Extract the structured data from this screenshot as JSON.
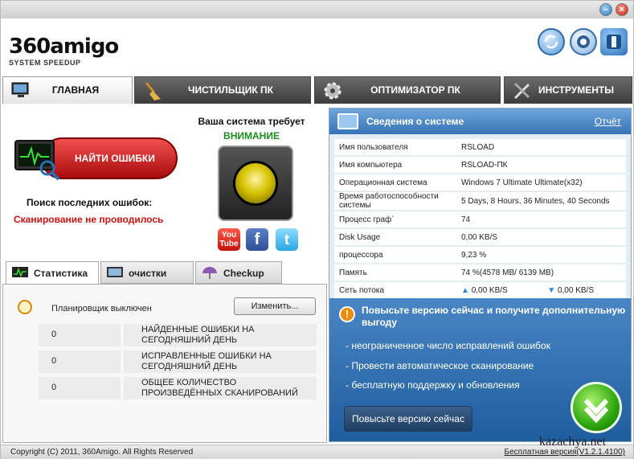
{
  "logo": {
    "brand": "360amigo",
    "sub": "SYSTEM SPEEDUP"
  },
  "window_controls": {
    "minimize_glyph": "–",
    "close_glyph": "×"
  },
  "header_icons": [
    "refresh-icon",
    "settings-gear-icon",
    "lifebuoy-icon"
  ],
  "tabs": [
    {
      "label": "ГЛАВНАЯ",
      "icon": "monitor-icon",
      "active": true
    },
    {
      "label": "ЧИСТИЛЬЩИК ПК",
      "icon": "broom-icon",
      "active": false
    },
    {
      "label": "ОПТИМИЗАТОР ПК",
      "icon": "gear-icon",
      "active": false
    },
    {
      "label": "ИНСТРУМЕНТЫ",
      "icon": "tools-icon",
      "active": false
    }
  ],
  "main": {
    "find_errors_label": "НАЙТИ ОШИБКИ",
    "search_title": "Поиск последних ошибок:",
    "scan_status": "Сканирование не проводилось",
    "system_requires": "Ваша система требует",
    "attention": "ВНИМАНИЕ",
    "social": {
      "youtube": "You Tube",
      "facebook": "f",
      "twitter": "t"
    }
  },
  "sub_tabs": [
    {
      "label": "Статистика",
      "icon": "chart-monitor-icon",
      "active": true
    },
    {
      "label": "очистки",
      "icon": "monitor-clean-icon",
      "active": false
    },
    {
      "label": "Checkup",
      "icon": "umbrella-icon",
      "active": false
    }
  ],
  "stats": {
    "scheduler": "Планировщик выключен",
    "change_button": "Изменить...",
    "rows": [
      {
        "value": "0",
        "label": "НАЙДЕННЫЕ ОШИБКИ НА СЕГОДНЯШНИЙ ДЕНЬ"
      },
      {
        "value": "0",
        "label": "ИСПРАВЛЕННЫЕ ОШИБКИ НА СЕГОДНЯШНИЙ ДЕНЬ"
      },
      {
        "value": "0",
        "label": "ОБЩЕЕ КОЛИЧЕСТВО ПРОИЗВЕДЁННЫХ СКАНИРОВАНИЙ"
      }
    ]
  },
  "sysinfo": {
    "title": "Сведения о системе",
    "report_link": "Отчёт",
    "rows": [
      {
        "key": "Имя пользователя",
        "value": "RSLOAD"
      },
      {
        "key": "Имя компьютера",
        "value": "RSLOAD-ПК"
      },
      {
        "key": "Операционная система",
        "value": "Windows 7 Ultimate Ultimate(x32)"
      },
      {
        "key": "Время работоспособности системы",
        "value": "5 Days, 8 Hours, 36 Minutes, 40 Seconds"
      },
      {
        "key": "Процесс граф`",
        "value": "74"
      },
      {
        "key": "Disk Usage",
        "value": "0,00 KB/S"
      },
      {
        "key": "процессора",
        "value": "9,23 %"
      },
      {
        "key": "Память",
        "value": "74 %(4578 MB/ 6139 MB)"
      }
    ],
    "network": {
      "key": "Сеть потока",
      "up": "0,00 KB/S",
      "down": "0,00 KB/S"
    }
  },
  "promo": {
    "title": "Повысьте версию сейчас и получите дополнительную выгоду",
    "features": [
      "- неограниченное число исправлений ошибок",
      "- Провести автоматическое сканирование",
      "- бесплатную поддержку и обновления"
    ],
    "button": "Повысьте версию сейчас"
  },
  "footer": {
    "copyright": "Copyright (C) 2011, 360Amigo. All Rights Reserved",
    "version": "Бесплатная версия(V1.2.1.4100)"
  },
  "watermark": "kazachya.net",
  "colors": {
    "accent_blue": "#3773b5",
    "alert_red": "#cc1111",
    "ok_green": "#1d8a1d",
    "tab_dark": "#3d3d3d"
  }
}
